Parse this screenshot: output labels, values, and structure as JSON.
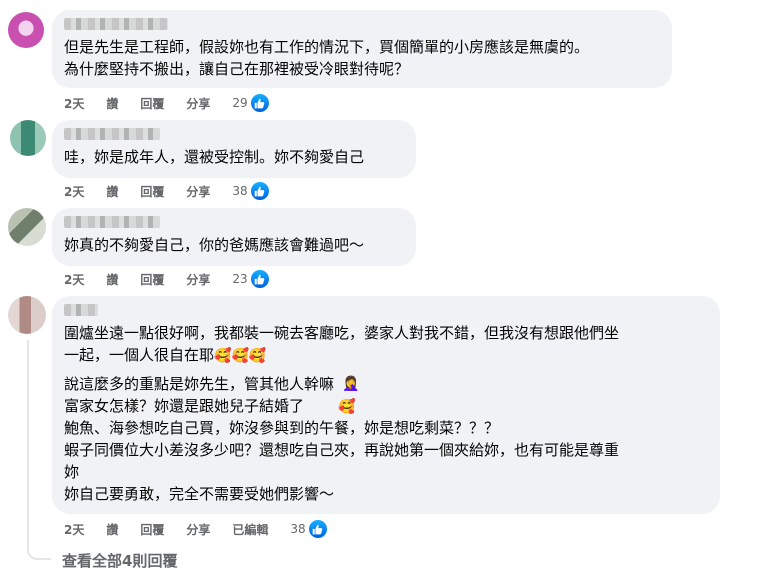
{
  "comments": [
    {
      "lines": [
        "但是先生是工程師，假設妳也有工作的情況下，買個簡單的小房應該是無虞的。",
        "為什麼堅持不搬出，讓自己在那裡被受冷眼對待呢？"
      ],
      "time": "2天",
      "like": "讚",
      "reply": "回覆",
      "share": "分享",
      "count": "29",
      "avatar_color": "#c94fb0"
    },
    {
      "lines": [
        "哇，妳是成年人，還被受控制。妳不夠愛自己"
      ],
      "time": "2天",
      "like": "讚",
      "reply": "回覆",
      "share": "分享",
      "count": "38",
      "avatar_color": "#3d8a74"
    },
    {
      "lines": [
        "妳真的不夠愛自己，你的爸媽應該會難過吧～"
      ],
      "time": "2天",
      "like": "讚",
      "reply": "回覆",
      "share": "分享",
      "count": "23",
      "avatar_color": "#8a9a86"
    },
    {
      "paragraph1": "圍爐坐遠一點很好啊，我都裝一碗去客廳吃，婆家人對我不錯，但我沒有想跟他們坐\n一起，一個人很自在耶",
      "paragraph2": "說這麼多的重點是妳先生，管其他人幹嘛\n富家女怎樣？妳還是跟她兒子結婚了\n鮑魚、海參想吃自己買，妳沒參與到的午餐，妳是想吃剩菜？？？\n蝦子同價位大小差沒多少吧？還想吃自己夾，再說她第一個夾給妳，也有可能是尊重\n妳\n妳自己要勇敢，完全不需要受她們影響～",
      "time": "2天",
      "like": "讚",
      "reply": "回覆",
      "share": "分享",
      "edited": "已編輯",
      "count": "38",
      "avatar_color": "#c8a8a0"
    }
  ],
  "view_all_replies": "查看全部4則回覆",
  "colors": {
    "bubble": "#f0f2f5",
    "meta": "#65676b",
    "like_blue": "#0866ff"
  },
  "icons": {
    "like": "thumbs-up-icon",
    "emoji_hearts": "smiling-face-with-hearts-icon",
    "emoji_facepalm": "woman-facepalming-icon"
  }
}
